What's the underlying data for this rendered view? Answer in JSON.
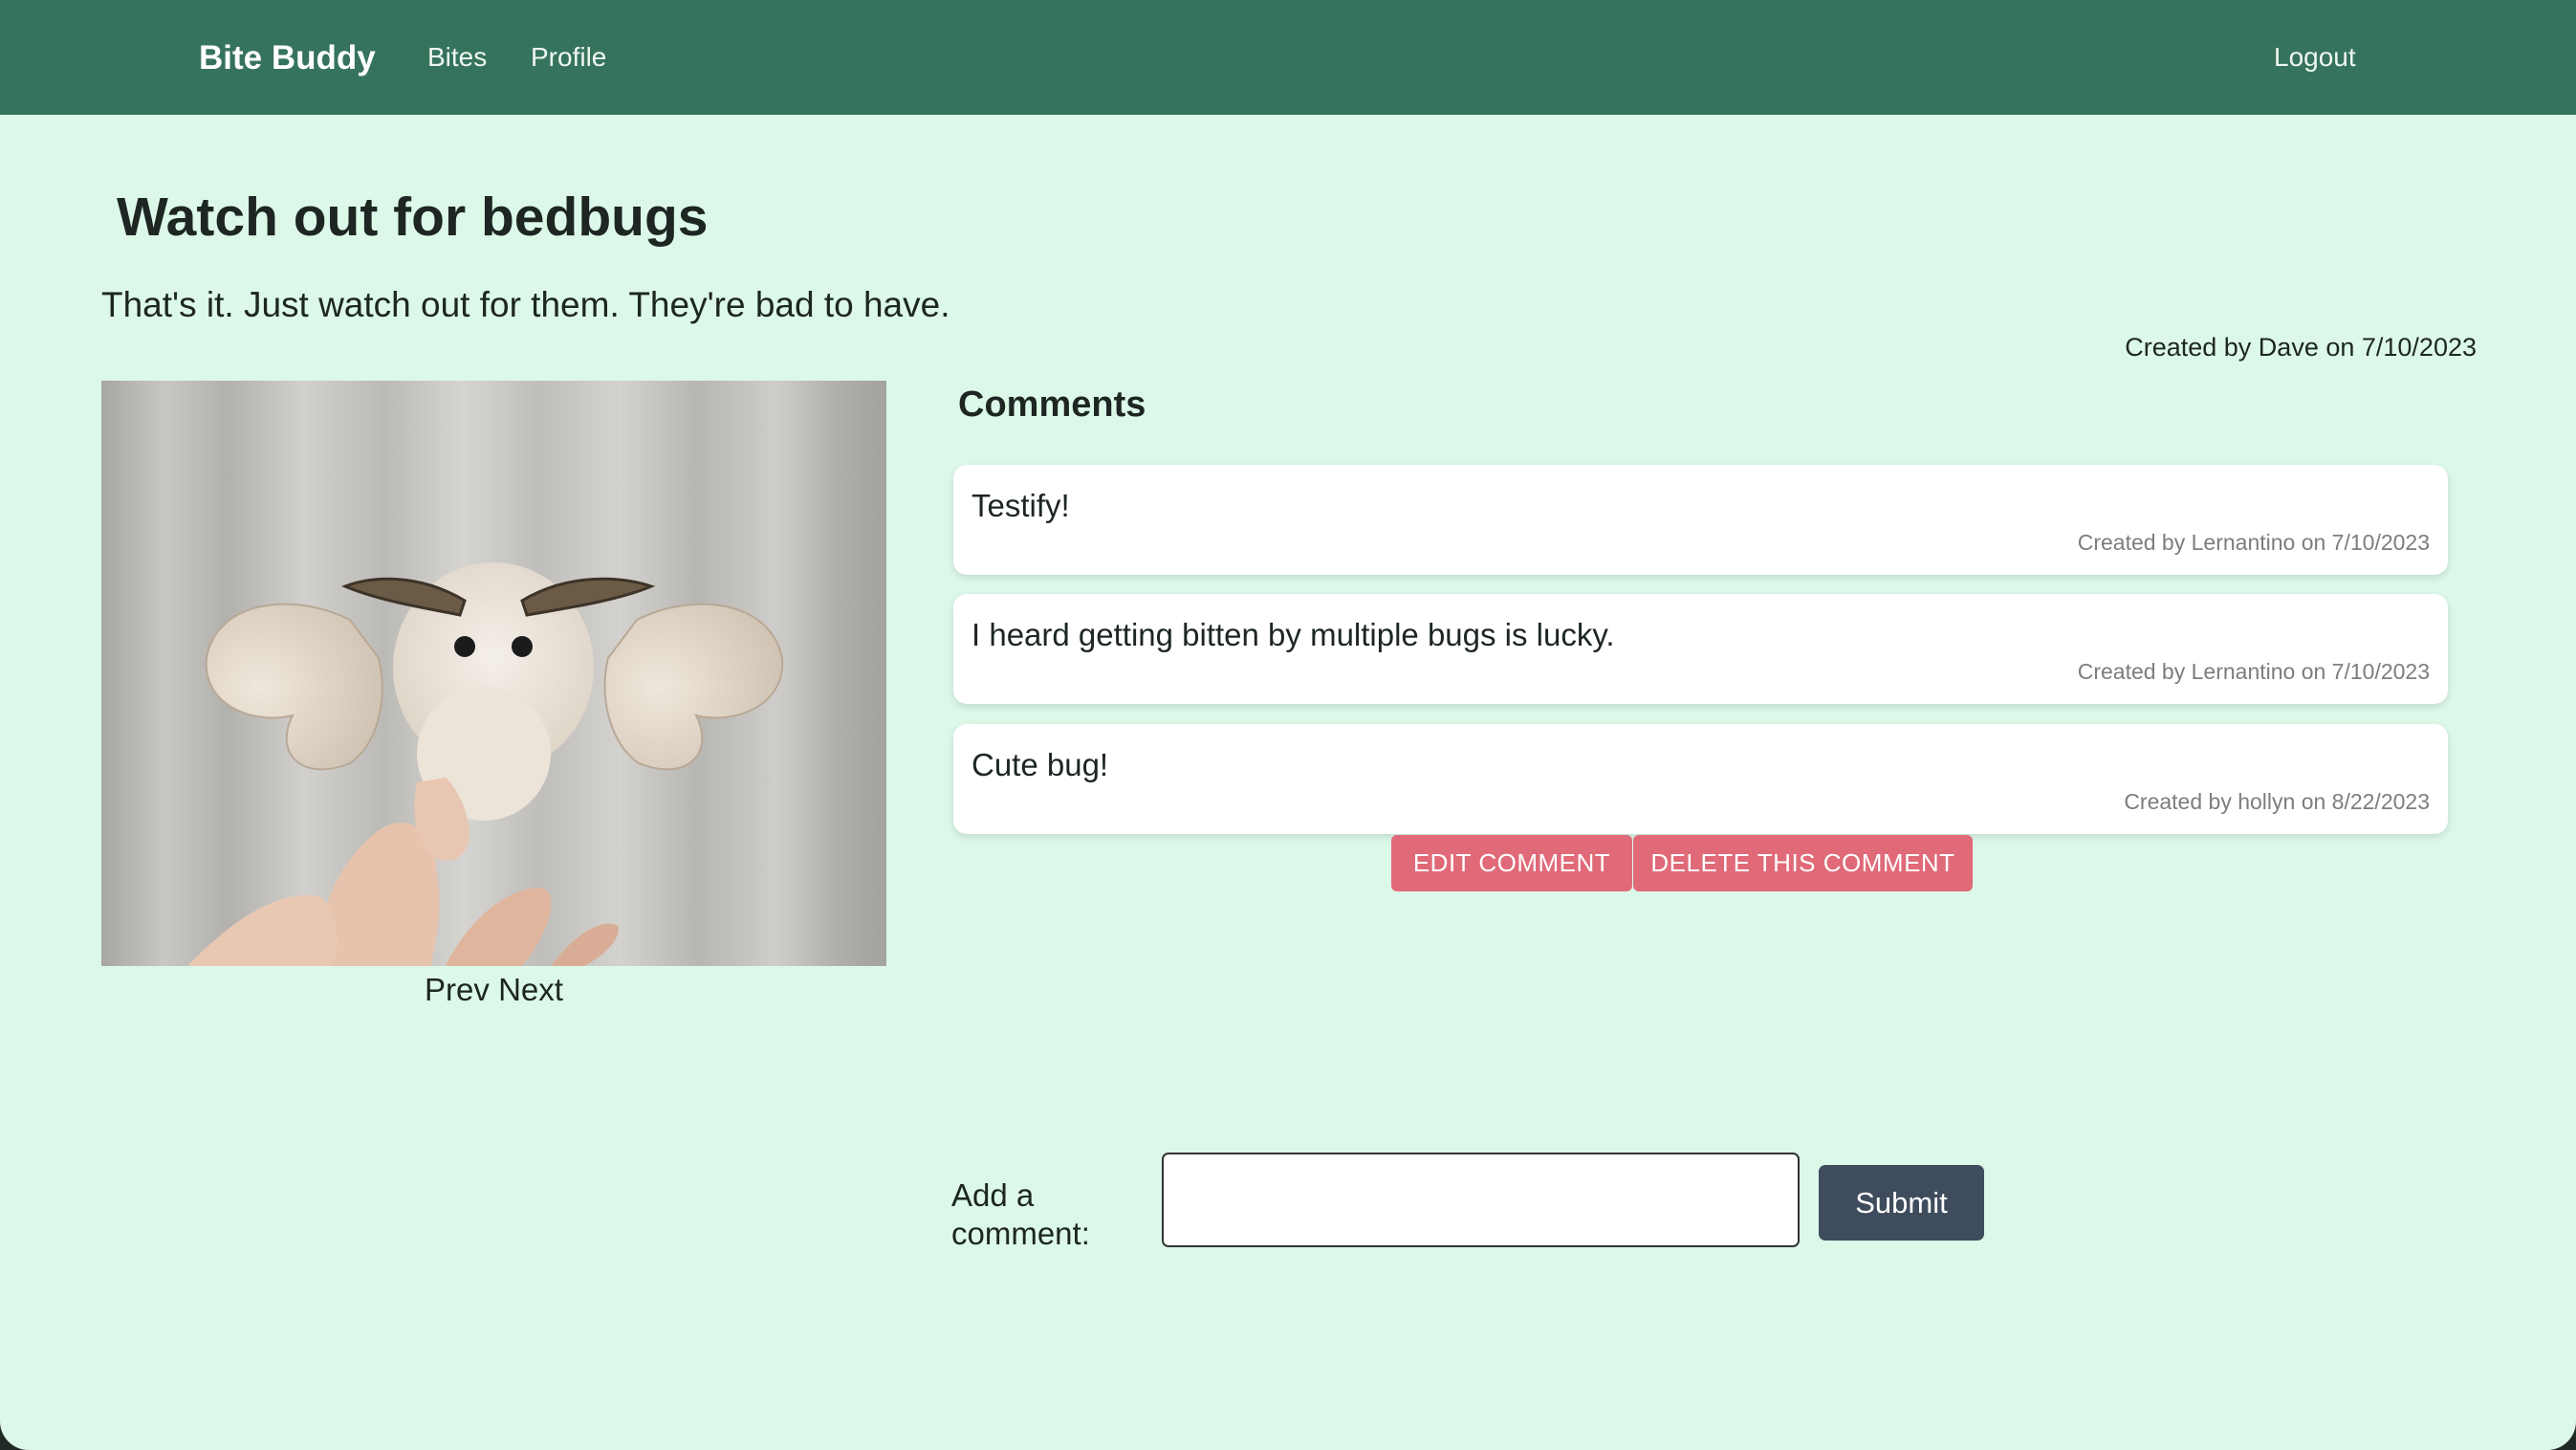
{
  "nav": {
    "brand": "Bite Buddy",
    "links": [
      "Bites",
      "Profile"
    ],
    "logout": "Logout"
  },
  "post": {
    "title": "Watch out for bedbugs",
    "description": "That's it. Just watch out for them. They're bad to have.",
    "meta": "Created by Dave on 7/10/2023",
    "image_icon": "moth-photo"
  },
  "pager": {
    "prev": "Prev",
    "next": "Next"
  },
  "comments": {
    "heading": "Comments",
    "items": [
      {
        "text": "Testify!",
        "meta": "Created by Lernantino on 7/10/2023"
      },
      {
        "text": "I heard getting bitten by multiple bugs is lucky.",
        "meta": "Created by Lernantino on 7/10/2023"
      },
      {
        "text": "Cute bug!",
        "meta": "Created by hollyn on 8/22/2023"
      }
    ],
    "edit_label": "EDIT COMMENT",
    "delete_label": "DELETE THIS COMMENT"
  },
  "add_comment": {
    "label": "Add a comment:",
    "value": "",
    "submit_label": "Submit"
  },
  "colors": {
    "navbar": "#36735c",
    "page_bg": "#dcf8e9",
    "danger": "#e06a78",
    "submit": "#3f4c5d"
  }
}
